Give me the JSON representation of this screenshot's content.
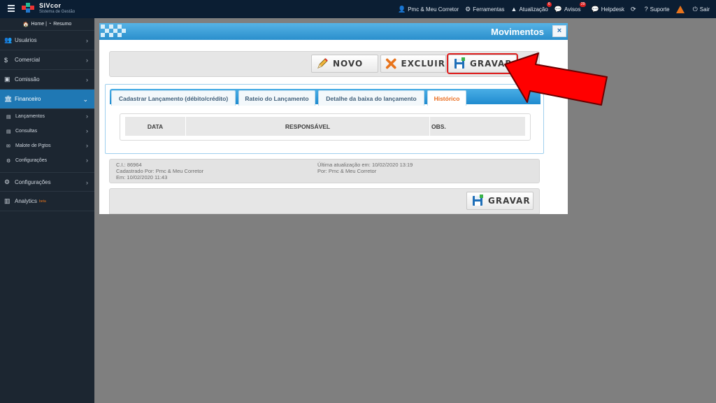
{
  "topbar": {
    "brand_name": "SIVcor",
    "brand_sub": "Sistema de Gestão",
    "nav": [
      {
        "icon": "user-icon",
        "label": "Pmc & Meu Corretor"
      },
      {
        "icon": "gears-icon",
        "label": "Ferramentas"
      },
      {
        "icon": "warning-icon",
        "label": "Atualização",
        "badge": "6"
      },
      {
        "icon": "chat-icon",
        "label": "Avisos",
        "badge": "29"
      },
      {
        "icon": "comments-icon",
        "label": "Helpdesk"
      },
      {
        "icon": "refresh-icon",
        "label": ""
      },
      {
        "icon": "question-icon",
        "label": "Suporte"
      },
      {
        "icon": "power-icon",
        "label": "Sair"
      }
    ]
  },
  "sidebar": {
    "home": "Home",
    "resumo": "Resumo",
    "items": [
      {
        "label": "Usuários",
        "icon": "users-icon"
      },
      {
        "label": "Comercial",
        "icon": "dollar-icon"
      },
      {
        "label": "Comissão",
        "icon": "money-icon"
      },
      {
        "label": "Financeiro",
        "icon": "bank-icon",
        "active": true
      },
      {
        "label": "Configurações",
        "icon": "gears-icon"
      },
      {
        "label": "Analytics",
        "icon": "chart-icon",
        "badge": "beta"
      }
    ],
    "subitems": [
      {
        "label": "Lançamentos",
        "icon": "file-icon"
      },
      {
        "label": "Consultas",
        "icon": "file-icon"
      },
      {
        "label": "Malote de Pgtos",
        "icon": "envelope-icon"
      },
      {
        "label": "Configurações",
        "icon": "gear-icon"
      }
    ]
  },
  "modal": {
    "title": "Movimentos",
    "close": "×",
    "toolbar": {
      "novo": "NOVO",
      "excluir": "EXCLUIR",
      "gravar": "GRAVAR"
    },
    "tabs": [
      {
        "label": "Cadastrar Lançamento (débito/crédito)"
      },
      {
        "label": "Rateio do Lançamento"
      },
      {
        "label": "Detalhe da baixa do lançamento"
      },
      {
        "label": "Histórico",
        "active": true
      }
    ],
    "grid_columns": [
      "DATA",
      "RESPONSÁVEL",
      "OBS."
    ],
    "info": {
      "ci": "C.I.: 86964",
      "cadastrado_por": "Cadastrado Por: Pmc & Meu Corretor",
      "em": "Em: 10/02/2020 11:43",
      "ultima_atualizacao": "Última atualização em: 10/02/2020 13:19",
      "por": "Por: Pmc & Meu Corretor"
    },
    "footer_gravar": "GRAVAR"
  },
  "colors": {
    "topbar": "#0b1e33",
    "sidebar": "#1c2631",
    "sidebar_active": "#1f78b4",
    "modal_header": "#2a8fcc",
    "active_tab_text": "#ea6b1c",
    "highlight": "#e02020",
    "arrow": "#ff0000"
  }
}
